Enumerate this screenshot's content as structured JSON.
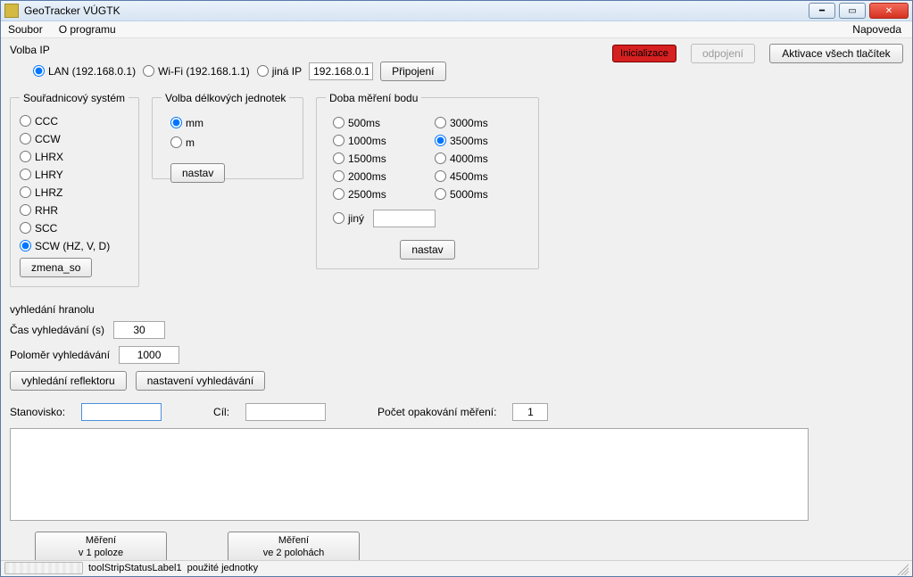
{
  "window": {
    "title": "GeoTracker VÚGTK"
  },
  "menu": {
    "soubor": "Soubor",
    "oprogramu": "O programu",
    "napoveda": "Napoveda"
  },
  "ip": {
    "heading": "Volba IP",
    "lan": "LAN (192.168.0.1)",
    "wifi": "Wi-Fi (192.168.1.1)",
    "other": "jiná IP",
    "value": "192.168.0.1",
    "connect": "Připojení",
    "selected": "lan"
  },
  "top_buttons": {
    "init": "Inicializace",
    "disconnect": "odpojení",
    "activate": "Aktivace všech tlačíтek"
  },
  "coord": {
    "heading": "Souřadnicový systém",
    "options": [
      "CCC",
      "CCW",
      "LHRX",
      "LHRY",
      "LHRZ",
      "RHR",
      "SCC",
      "SCW (HZ, V, D)"
    ],
    "selected": 7,
    "change": "zmena_so"
  },
  "units": {
    "heading": "Volba délkových jednotek",
    "mm": "mm",
    "m": "m",
    "selected": "mm",
    "set": "nastav"
  },
  "doba": {
    "heading": "Doba měření bodu",
    "left": [
      "500ms",
      "1000ms",
      "1500ms",
      "2000ms",
      "2500ms"
    ],
    "right": [
      "3000ms",
      "3500ms",
      "4000ms",
      "4500ms",
      "5000ms"
    ],
    "selected": "3500ms",
    "other_label": "jiný",
    "other_value": "",
    "set": "nastav"
  },
  "search": {
    "heading": "vyhledání hranolu",
    "time_label": "Čas vyhledávání (s)",
    "time_value": "30",
    "radius_label": "Poloměr vyhledávání",
    "radius_value": "1000",
    "find_btn": "vyhledání reflektoru",
    "settings_btn": "nastavení vyhledávání"
  },
  "inputs": {
    "stanovisko_label": "Stanovisko:",
    "stanovisko_value": "",
    "cil_label": "Cíl:",
    "cil_value": "",
    "repeat_label": "Počet opakování měření:",
    "repeat_value": "1"
  },
  "measure": {
    "one_l1": "Měření",
    "one_l2": "v 1 poloze",
    "two_l1": "Měření",
    "two_l2": "ve 2 polohách"
  },
  "status": {
    "label1": "toolStripStatusLabel1",
    "label2": "použité jednotky"
  }
}
